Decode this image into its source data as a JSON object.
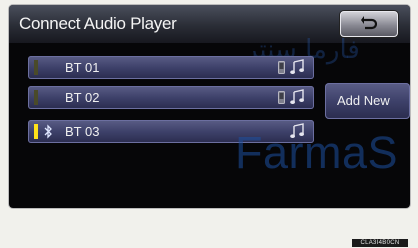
{
  "header": {
    "title": "Connect Audio Player",
    "back_icon": "return-arrow-icon"
  },
  "devices": [
    {
      "name": "BT 01",
      "connected": false,
      "icons": [
        "phone-icon",
        "music-note-icon"
      ]
    },
    {
      "name": "BT 02",
      "connected": false,
      "icons": [
        "phone-icon",
        "music-note-icon"
      ]
    },
    {
      "name": "BT 03",
      "connected": true,
      "icons": [
        "bluetooth-icon",
        "music-note-icon"
      ]
    }
  ],
  "actions": {
    "add_new_label": "Add New"
  },
  "watermark": {
    "arabic": "فارما سنتر",
    "latin": "FarmaS"
  },
  "footer": {
    "code": "CLA3I4B0CN"
  },
  "colors": {
    "indicator_active": "#ffe21a",
    "button_base": "#3e416a",
    "screen_background": "#060608"
  }
}
